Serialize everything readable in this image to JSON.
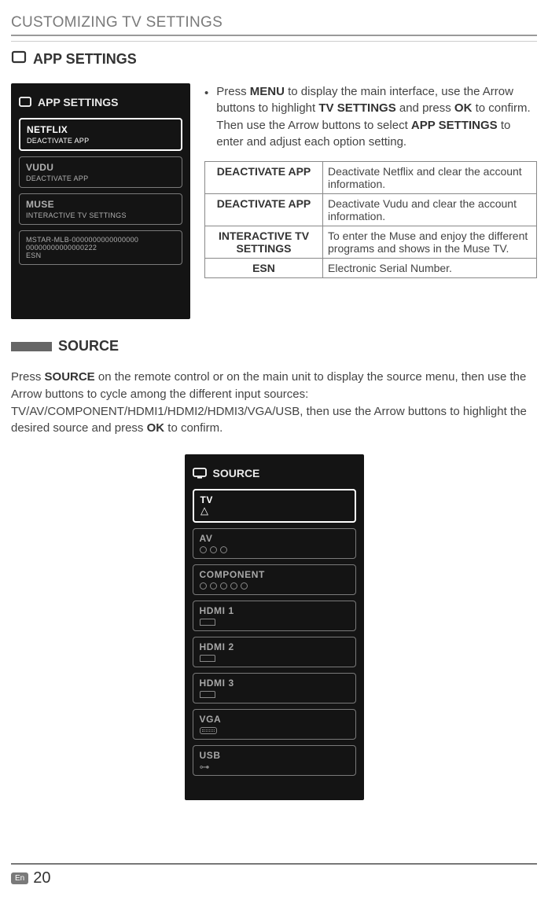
{
  "chapter": "CUSTOMIZING TV SETTINGS",
  "appSettings": {
    "heading": "APP SETTINGS",
    "panelTitle": "APP SETTINGS",
    "items": [
      {
        "label": "NETFLIX",
        "sub": "DEACTIVATE APP"
      },
      {
        "label": "VUDU",
        "sub": "DEACTIVATE APP"
      },
      {
        "label": "MUSE",
        "sub": "INTERACTIVE TV SETTINGS"
      }
    ],
    "esnItem": {
      "line1": "MSTAR-MLB-0000000000000000",
      "line2": "00000000000000222",
      "line3": "ESN"
    },
    "bullet": {
      "pre": "Press ",
      "menu": "MENU",
      "mid1": " to display the main interface, use the Arrow buttons to highlight ",
      "tvset": "TV SETTINGS",
      "mid2": " and press ",
      "ok": "OK",
      "mid3": " to confirm. Then use the Arrow buttons to select ",
      "appset": "APP SETTINGS",
      "end": " to enter and adjust each option setting."
    },
    "table": [
      {
        "k": "DEACTIVATE APP",
        "v": "Deactivate Netflix and clear the account information."
      },
      {
        "k": "DEACTIVATE APP",
        "v": "Deactivate Vudu and clear the account information."
      },
      {
        "k": "INTERACTIVE TV SETTINGS",
        "v": "To enter the Muse and enjoy the different programs and shows in the Muse TV."
      },
      {
        "k": "ESN",
        "v": "Electronic Serial Number."
      }
    ]
  },
  "source": {
    "heading": "SOURCE",
    "panelTitle": "SOURCE",
    "para": {
      "pre": "Press ",
      "src": "SOURCE",
      "mid": " on the remote control or on the main unit to display the source menu, then use the Arrow buttons to cycle among the different input sources: TV/AV/COMPONENT/HDMI1/HDMI2/HDMI3/VGA/USB, then use the Arrow buttons to highlight the desired source and press ",
      "ok": "OK",
      "end": " to confirm."
    },
    "items": [
      "TV",
      "AV",
      "COMPONENT",
      "HDMI 1",
      "HDMI 2",
      "HDMI 3",
      "VGA",
      "USB"
    ]
  },
  "footer": {
    "lang": "En",
    "page": "20"
  }
}
